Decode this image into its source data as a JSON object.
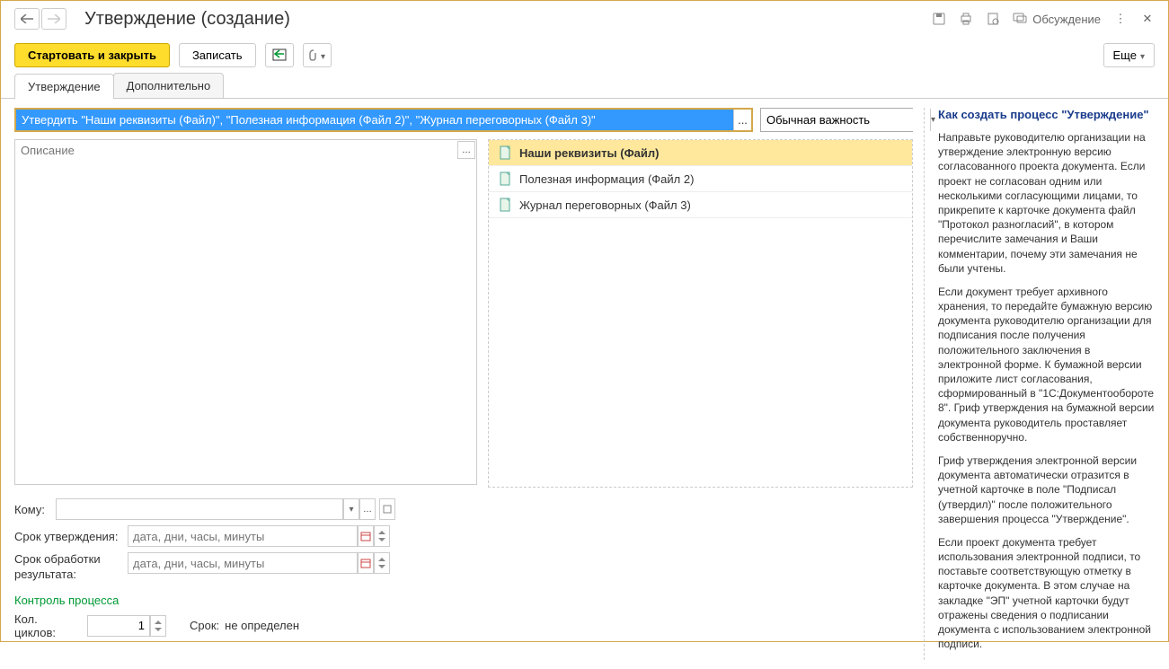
{
  "header": {
    "title": "Утверждение (создание)",
    "discuss": "Обсуждение"
  },
  "toolbar": {
    "start_close": "Стартовать и закрыть",
    "save": "Записать",
    "more": "Еще"
  },
  "tabs": {
    "approval": "Утверждение",
    "additional": "Дополнительно"
  },
  "subject": {
    "value": "Утвердить \"Наши реквизиты (Файл)\", \"Полезная информация (Файл 2)\", \"Журнал переговорных (Файл 3)\"",
    "ellipsis": "..."
  },
  "importance": {
    "value": "Обычная важность"
  },
  "description": {
    "placeholder": "Описание"
  },
  "files": [
    {
      "name": "Наши реквизиты (Файл)",
      "selected": true
    },
    {
      "name": "Полезная информация (Файл 2)",
      "selected": false
    },
    {
      "name": "Журнал переговорных (Файл 3)",
      "selected": false
    }
  ],
  "form": {
    "to_label": "Кому:",
    "approve_date_label": "Срок утверждения:",
    "result_date_label": "Срок обработки результата:",
    "date_placeholder": "дата, дни, часы, минуты",
    "process_control": "Контроль процесса",
    "cycles_label": "Кол. циклов:",
    "cycles_value": "1",
    "term_label": "Срок:",
    "term_value": "не определен"
  },
  "help": {
    "title": "Как создать процесс \"Утверждение\"",
    "p1": "Направьте руководителю организации на утверждение электронную версию согласованного проекта документа. Если проект не согласован одним или несколькими согласующими лицами, то прикрепите к карточке документа файл \"Протокол разногласий\", в котором перечислите замечания и Ваши комментарии, почему эти замечания не были учтены.",
    "p2": "Если документ требует архивного хранения, то передайте бумажную версию документа руководителю организации для подписания после получения положительного заключения в электронной форме. К бумажной версии приложите лист согласования, сформированный в \"1С:Документообороте 8\". Гриф утверждения на бумажной версии документа руководитель проставляет собственноручно.",
    "p3": "Гриф утверждения электронной версии документа автоматически отразится в учетной карточке в поле \"Подписал (утвердил)\" после положительного завершения процесса \"Утверждение\".",
    "p4": "Если проект документа требует использования электронной подписи, то поставьте соответствующую отметку в карточке документа. В этом случае на закладке \"ЭП\" учетной карточки будут отражены сведения о подписании документа с использованием электронной подписи."
  }
}
